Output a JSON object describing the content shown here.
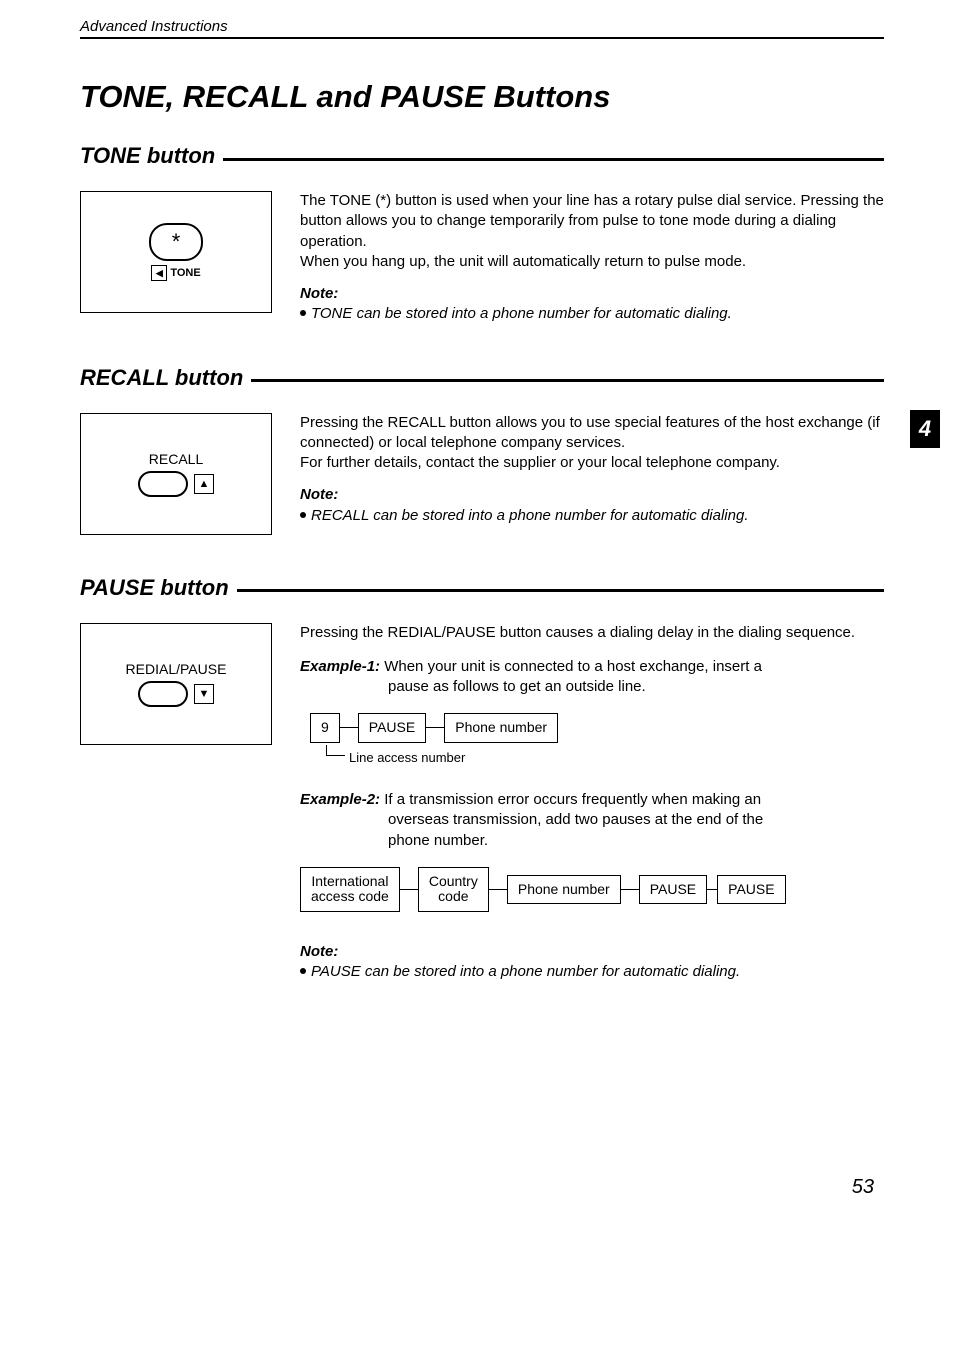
{
  "header": "Advanced Instructions",
  "title": "TONE, RECALL and PAUSE Buttons",
  "side_tab": "4",
  "page_number": "53",
  "tone": {
    "heading": "TONE button",
    "icon_char": "*",
    "icon_arrow": "◀",
    "icon_label": "TONE",
    "p1": "The TONE (*) button is used when your line has a rotary pulse dial service. Pressing the button allows you to change temporarily from pulse to tone mode during a dialing operation.",
    "p2": "When you hang up, the unit will automatically return to pulse mode.",
    "note_label": "Note:",
    "note": "TONE can be stored into a phone number for automatic dialing."
  },
  "recall": {
    "heading": "RECALL button",
    "icon_label": "RECALL",
    "icon_arrow": "▲",
    "p1": "Pressing the RECALL button allows you to use special features of the host exchange (if connected) or local telephone company services.",
    "p2": "For further details, contact the supplier or your local telephone company.",
    "note_label": "Note:",
    "note": "RECALL can be stored into a phone number for automatic dialing."
  },
  "pause": {
    "heading": "PAUSE button",
    "icon_label": "REDIAL/PAUSE",
    "icon_arrow": "▼",
    "p1": "Pressing the REDIAL/PAUSE button causes a dialing delay in the dialing sequence.",
    "ex1_label": "Example-1:",
    "ex1_text_a": "When your unit is connected to a host exchange, insert a",
    "ex1_text_b": "pause as follows to get an outside line.",
    "seq1": {
      "a": "9",
      "b": "PAUSE",
      "c": "Phone number",
      "sub": "Line access number"
    },
    "ex2_label": "Example-2:",
    "ex2_text_a": "If a transmission error occurs frequently when making an",
    "ex2_text_b": "overseas transmission, add two pauses at the end of the",
    "ex2_text_c": "phone number.",
    "seq2": {
      "a1": "International",
      "a2": "access code",
      "b1": "Country",
      "b2": "code",
      "c": "Phone number",
      "d": "PAUSE",
      "e": "PAUSE"
    },
    "note_label": "Note:",
    "note": "PAUSE can be stored into a phone number for automatic dialing."
  }
}
